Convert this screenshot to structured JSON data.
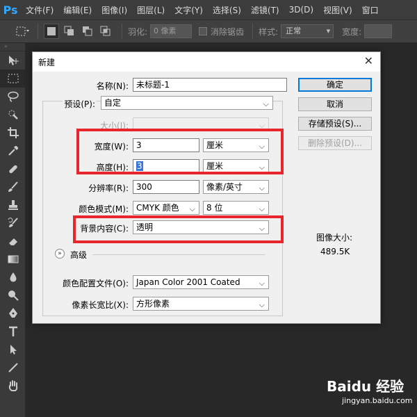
{
  "app": {
    "logo": "Ps"
  },
  "menu": [
    {
      "label": "文件(F)"
    },
    {
      "label": "编辑(E)"
    },
    {
      "label": "图像(I)"
    },
    {
      "label": "图层(L)"
    },
    {
      "label": "文字(Y)"
    },
    {
      "label": "选择(S)"
    },
    {
      "label": "滤镜(T)"
    },
    {
      "label": "3D(D)"
    },
    {
      "label": "视图(V)"
    },
    {
      "label": "窗口"
    }
  ],
  "options": {
    "feather_label": "羽化:",
    "feather_value": "0 像素",
    "antialias_label": "消除锯齿",
    "style_label": "样式:",
    "style_value": "正常",
    "width_label": "宽度:"
  },
  "toolbar": {
    "grip": "»",
    "tools": [
      "move-icon",
      "marquee-icon",
      "lasso-icon",
      "quick-select-icon",
      "crop-icon",
      "eyedropper-icon",
      "healing-icon",
      "brush-icon",
      "stamp-icon",
      "history-brush-icon",
      "eraser-icon",
      "gradient-icon",
      "blur-icon",
      "dodge-icon",
      "pen-icon",
      "type-icon",
      "path-select-icon",
      "line-icon",
      "hand-icon"
    ]
  },
  "dialog": {
    "title": "新建",
    "close": "✕",
    "name_label": "名称(N):",
    "name_value": "未标题-1",
    "preset_label": "预设(P):",
    "preset_value": "自定",
    "size_label": "大小(I):",
    "width_label": "宽度(W):",
    "width_value": "3",
    "width_unit": "厘米",
    "height_label": "高度(H):",
    "height_value": "3",
    "height_unit": "厘米",
    "resolution_label": "分辨率(R):",
    "resolution_value": "300",
    "resolution_unit": "像素/英寸",
    "colormode_label": "颜色模式(M):",
    "colormode_value": "CMYK 颜色",
    "colormode_bits": "8 位",
    "background_label": "背景内容(C):",
    "background_value": "透明",
    "advanced_icon": "»",
    "advanced_label": "高级",
    "profile_label": "颜色配置文件(O):",
    "profile_value": "Japan Color 2001 Coated",
    "aspect_label": "像素长宽比(X):",
    "aspect_value": "方形像素",
    "ok_label": "确定",
    "cancel_label": "取消",
    "save_preset_label": "存储预设(S)...",
    "delete_preset_label": "删除预设(D)...",
    "image_size_label": "图像大小:",
    "image_size_value": "489.5K"
  },
  "colors": {
    "highlight": "#e8262c",
    "accent": "#0078d7",
    "selection": "#3875d7"
  },
  "watermark": {
    "brand": "Baidu 经验",
    "site": "jingyan.baidu.com"
  }
}
